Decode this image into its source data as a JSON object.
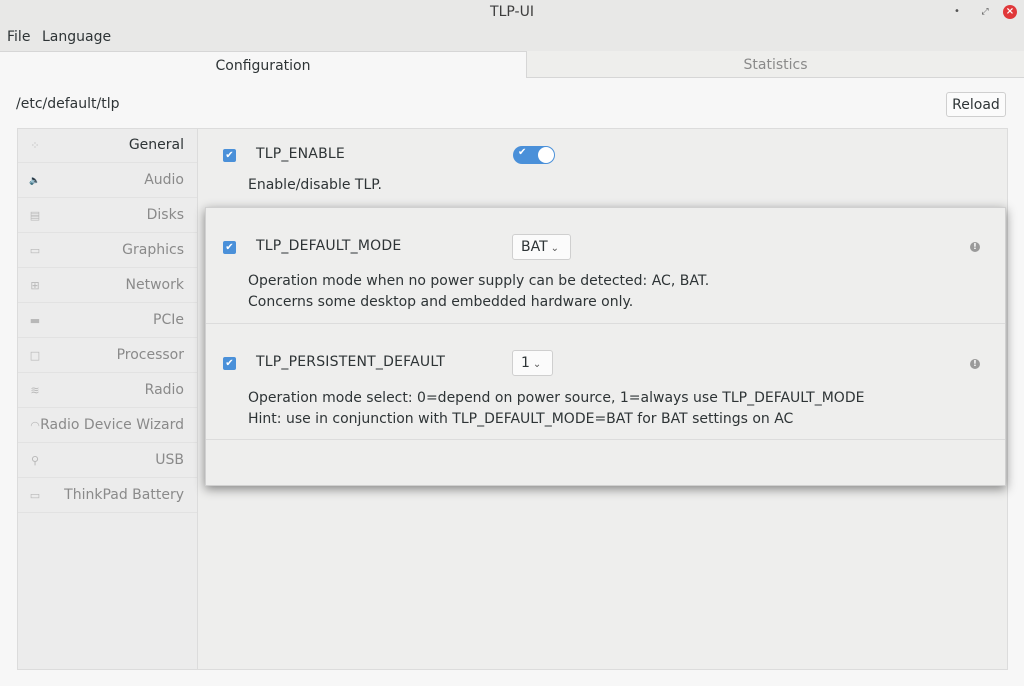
{
  "window": {
    "title": "TLP-UI",
    "minimize_glyph": "•",
    "maximize_glyph": "⤢",
    "close_glyph": "×"
  },
  "menubar": {
    "items": [
      "File",
      "Language"
    ]
  },
  "tabs": [
    {
      "label": "Configuration",
      "active": true
    },
    {
      "label": "Statistics",
      "active": false
    }
  ],
  "config_path": "/etc/default/tlp",
  "reload_label": "Reload",
  "sidebar": {
    "items": [
      {
        "label": "General",
        "icon": "grid-icon",
        "glyph": "⁘",
        "active": true
      },
      {
        "label": "Audio",
        "icon": "speaker-icon",
        "glyph": "🔈"
      },
      {
        "label": "Disks",
        "icon": "disk-icon",
        "glyph": "▤"
      },
      {
        "label": "Graphics",
        "icon": "monitor-icon",
        "glyph": "▭"
      },
      {
        "label": "Network",
        "icon": "network-icon",
        "glyph": "⊞"
      },
      {
        "label": "PCIe",
        "icon": "card-icon",
        "glyph": "▬"
      },
      {
        "label": "Processor",
        "icon": "chip-icon",
        "glyph": "□"
      },
      {
        "label": "Radio",
        "icon": "wifi-icon",
        "glyph": "≋"
      },
      {
        "label": "Radio Device Wizard",
        "icon": "wizard-icon",
        "glyph": "◠"
      },
      {
        "label": "USB",
        "icon": "usb-icon",
        "glyph": "⚲"
      },
      {
        "label": "ThinkPad Battery",
        "icon": "battery-icon",
        "glyph": "▭"
      }
    ]
  },
  "settings": {
    "tlp_enable": {
      "name": "TLP_ENABLE",
      "description": "Enable/disable TLP.",
      "checked": true,
      "value": true
    },
    "tlp_default_mode": {
      "name": "TLP_DEFAULT_MODE",
      "description_line1": "Operation mode when no power supply can be detected: AC, BAT.",
      "description_line2": "Concerns some desktop and embedded hardware only.",
      "checked": true,
      "value": "BAT"
    },
    "tlp_persistent_default": {
      "name": "TLP_PERSISTENT_DEFAULT",
      "description_line1": "Operation mode select: 0=depend on power source, 1=always use TLP_DEFAULT_MODE",
      "description_line2": "Hint: use in conjunction with TLP_DEFAULT_MODE=BAT for BAT settings on AC",
      "checked": true,
      "value": "1"
    }
  },
  "glyphs": {
    "check": "✔",
    "chevron": "⌄",
    "info": "!"
  },
  "colors": {
    "accent": "#4a90d9",
    "close_button": "#e0383a"
  }
}
